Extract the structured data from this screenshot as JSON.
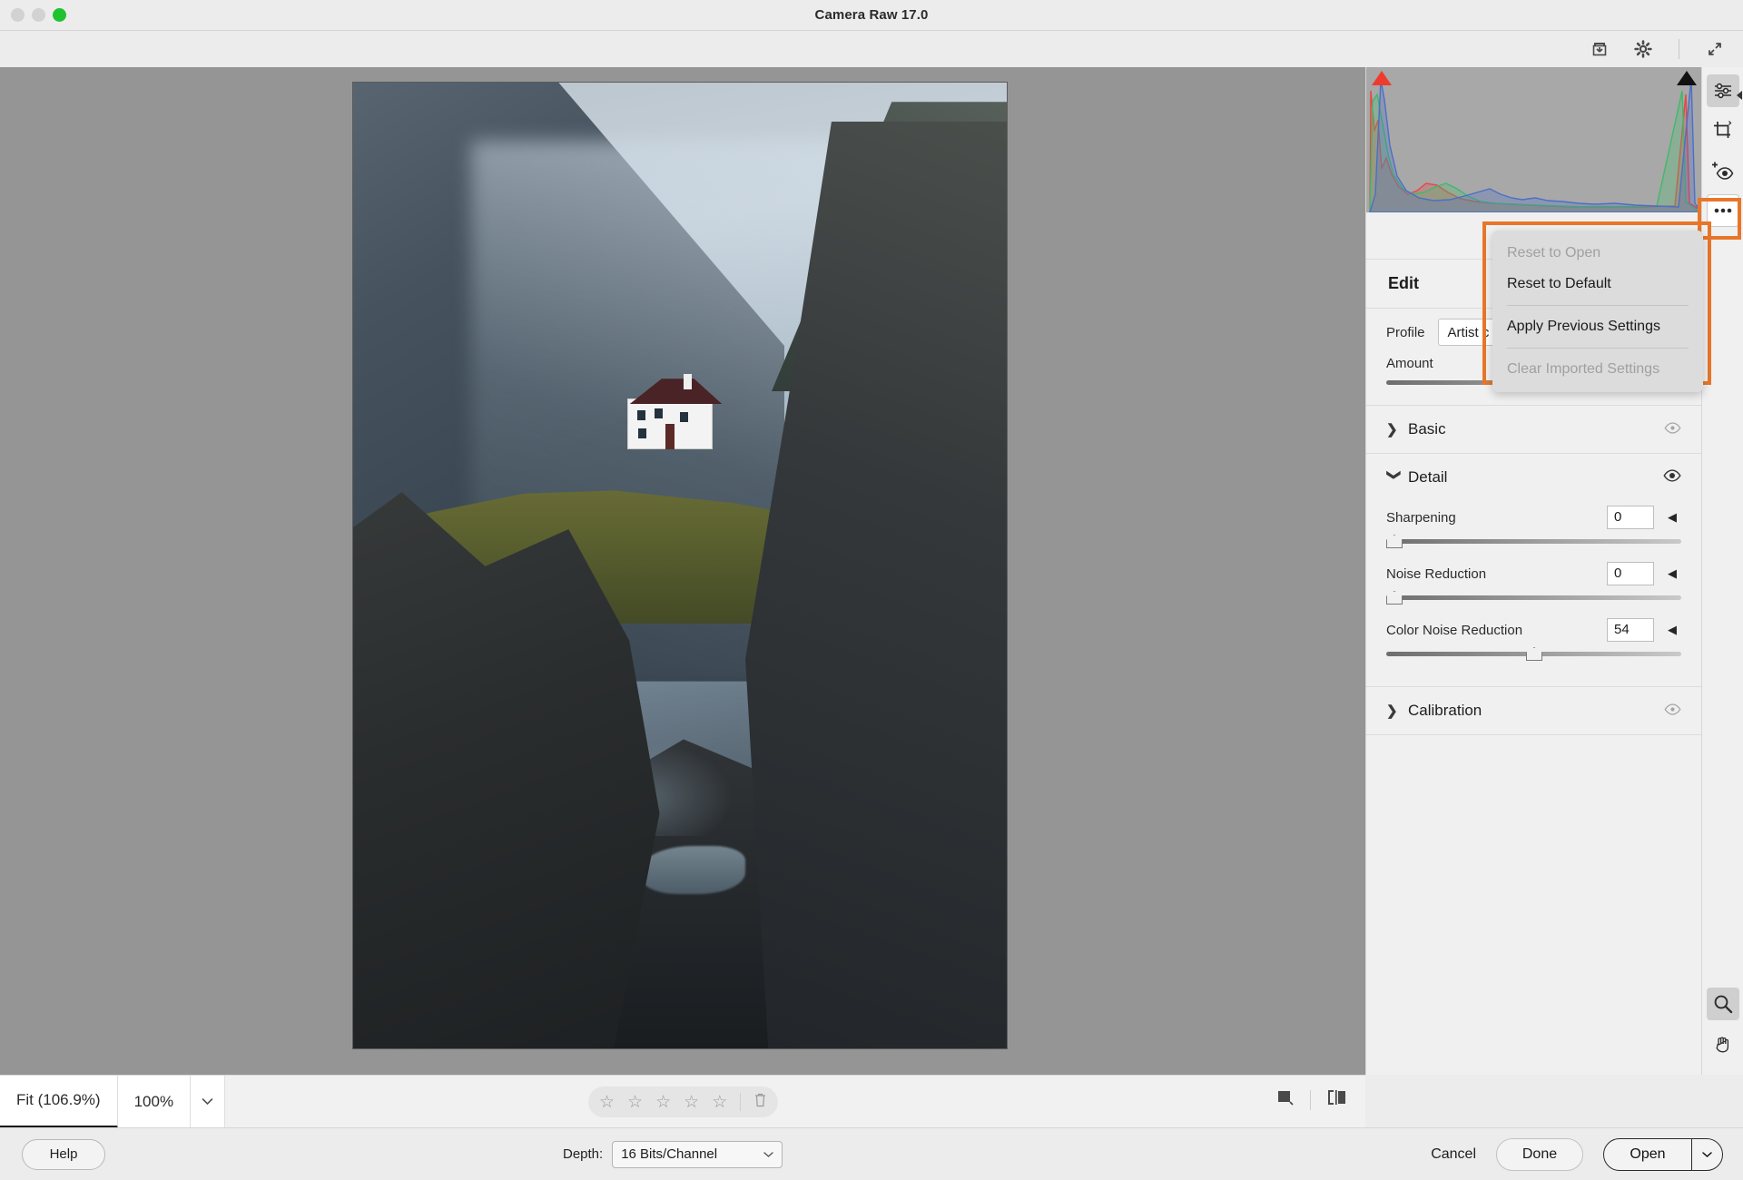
{
  "window": {
    "title": "Camera Raw 17.0",
    "traffic_lights": [
      "close",
      "minimize",
      "zoom"
    ]
  },
  "top_toolbar": {
    "icons": [
      {
        "name": "save-image-icon",
        "glyph": "save"
      },
      {
        "name": "preferences-gear-icon",
        "glyph": "gear"
      },
      {
        "name": "fullscreen-expand-icon",
        "glyph": "expand"
      }
    ]
  },
  "tool_rail": {
    "top_tools": [
      {
        "name": "edit-tool",
        "label": "Edit",
        "selected": true
      },
      {
        "name": "crop-tool",
        "label": "Crop & Rotate",
        "selected": false
      },
      {
        "name": "spot-removal-tool",
        "label": "Healing",
        "selected": false
      },
      {
        "name": "more-options-tool",
        "label": "More Image Settings",
        "selected": false,
        "highlighted": true
      }
    ],
    "bottom_tools": [
      {
        "name": "zoom-tool",
        "label": "Zoom",
        "selected": true
      },
      {
        "name": "hand-tool",
        "label": "Hand",
        "selected": false
      }
    ]
  },
  "more_menu": {
    "visible": true,
    "items": [
      {
        "label": "Reset to Open",
        "disabled": true
      },
      {
        "label": "Reset to Default",
        "disabled": false
      },
      {
        "separator_after": true
      },
      {
        "label": "Apply Previous Settings",
        "disabled": false
      },
      {
        "separator_after": true
      },
      {
        "label": "Clear Imported Settings",
        "disabled": true
      }
    ],
    "flat": [
      {
        "label": "Reset to Open",
        "disabled": true
      },
      {
        "label": "Reset to Default",
        "disabled": false
      },
      {
        "label": "Apply Previous Settings",
        "disabled": false
      },
      {
        "label": "Clear Imported Settings",
        "disabled": true
      }
    ]
  },
  "right_panel": {
    "edit_title": "Edit",
    "profile": {
      "label": "Profile",
      "value": "Artist c",
      "amount_label": "Amount"
    },
    "sections": [
      {
        "name": "basic",
        "title": "Basic",
        "expanded": false,
        "eye_on": false
      },
      {
        "name": "detail",
        "title": "Detail",
        "expanded": true,
        "eye_on": true
      },
      {
        "name": "calibration",
        "title": "Calibration",
        "expanded": false,
        "eye_on": false
      }
    ],
    "detail_sliders": [
      {
        "name": "sharpening",
        "label": "Sharpening",
        "value": "0",
        "percent": 0
      },
      {
        "name": "noise-reduction",
        "label": "Noise Reduction",
        "value": "0",
        "percent": 0
      },
      {
        "name": "color-noise-reduction",
        "label": "Color Noise Reduction",
        "value": "54",
        "percent": 53
      }
    ]
  },
  "histogram": {
    "shadow_clip_color": "#ef3b2d",
    "highlight_clip_color": "#111111",
    "channels": [
      "red",
      "green",
      "blue"
    ]
  },
  "bottom_bar": {
    "zoom_fit": "Fit (106.9%)",
    "zoom_100": "100%",
    "rating_stars": 5,
    "rating_value": 0,
    "star_glyph": "☆",
    "trash_glyph": "🗑",
    "view_tools": [
      {
        "name": "background-color-swatch"
      },
      {
        "name": "before-after-view"
      }
    ]
  },
  "footer": {
    "help_label": "Help",
    "depth_label": "Depth:",
    "depth_value": "16 Bits/Channel",
    "cancel_label": "Cancel",
    "done_label": "Done",
    "open_label": "Open"
  },
  "photo": {
    "description": "Icelandic landscape with white house and dark red roof in a mountain valley framed by basalt rock"
  },
  "colors": {
    "highlight_orange": "#e8762a",
    "panel_bg": "#f0f0f0",
    "canvas_bg": "#959595"
  }
}
